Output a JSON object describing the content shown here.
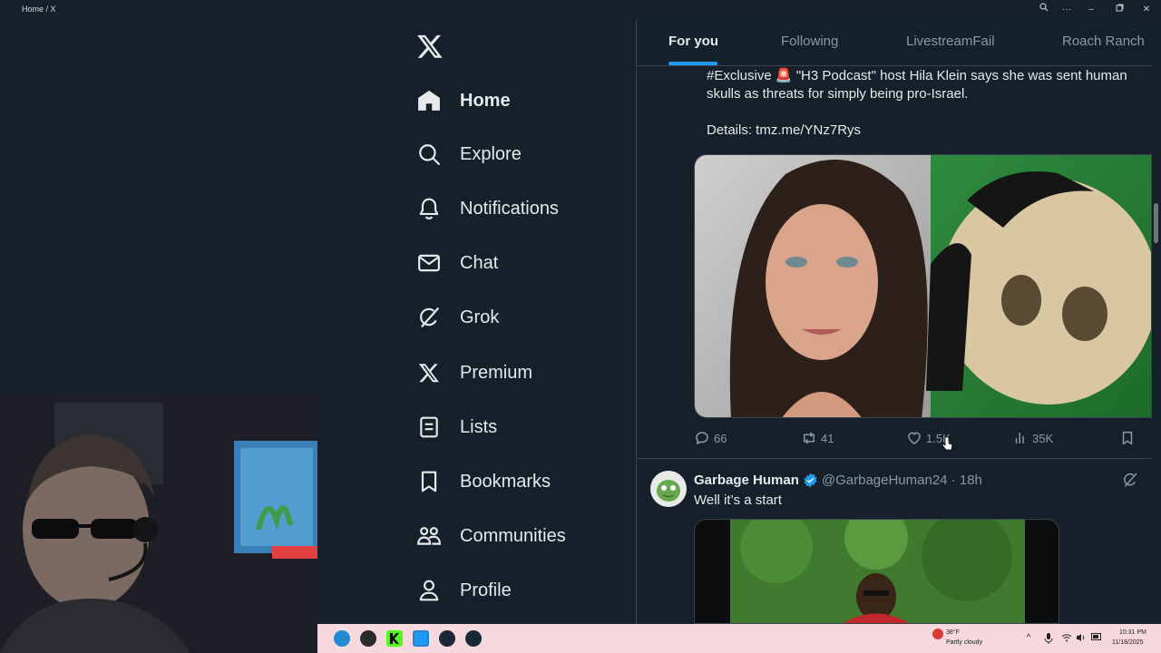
{
  "window": {
    "title": "Home / X",
    "controls": [
      "zoom-icon",
      "more-icon",
      "minimize-icon",
      "maximize-icon",
      "close-icon"
    ]
  },
  "nav": {
    "logo": "x-logo-icon",
    "items": [
      {
        "label": "Home",
        "icon": "home-icon",
        "active": true
      },
      {
        "label": "Explore",
        "icon": "search-icon"
      },
      {
        "label": "Notifications",
        "icon": "bell-icon"
      },
      {
        "label": "Chat",
        "icon": "mail-icon"
      },
      {
        "label": "Grok",
        "icon": "grok-icon"
      },
      {
        "label": "Premium",
        "icon": "x-premium-icon"
      },
      {
        "label": "Lists",
        "icon": "list-icon"
      },
      {
        "label": "Bookmarks",
        "icon": "bookmark-icon"
      },
      {
        "label": "Communities",
        "icon": "communities-icon"
      },
      {
        "label": "Profile",
        "icon": "profile-icon"
      }
    ]
  },
  "tabs": [
    {
      "label": "For you",
      "active": true
    },
    {
      "label": "Following"
    },
    {
      "label": "LivestreamFail"
    },
    {
      "label": "Roach Ranch"
    }
  ],
  "tweet1": {
    "text_line1": "#Exclusive 🚨 \"H3 Podcast\" host Hila Klein says she was sent human",
    "text_line2": "skulls as threats for simply being pro-Israel.",
    "details": "Details: tmz.me/YNz7Rys",
    "replies": "66",
    "reposts": "41",
    "likes": "1.5K",
    "views": "35K"
  },
  "tweet2": {
    "name": "Garbage Human",
    "handle": "@GarbageHuman24 · 18h",
    "verified": true,
    "text": "Well it’s a start"
  },
  "taskbar": {
    "weather_temp": "38°F",
    "weather_desc": "Partly cloudy",
    "time": "10:31 PM",
    "date": "11/18/2025"
  },
  "colors": {
    "background": "#15202b",
    "accent": "#1d9bf0",
    "text": "#e7e9ea",
    "muted": "#8b98a5",
    "border": "#38444d",
    "taskbar": "#f5d9de"
  }
}
